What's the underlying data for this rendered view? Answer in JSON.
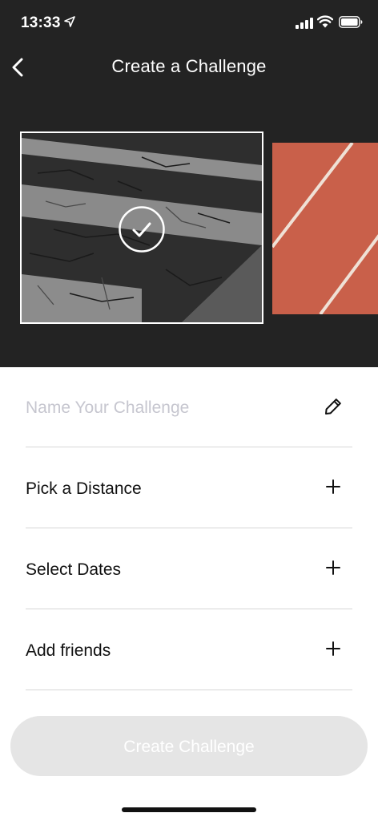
{
  "status_bar": {
    "time": "13:33",
    "icons": [
      "location-arrow-icon",
      "cellular-signal-icon",
      "wifi-icon",
      "battery-icon"
    ]
  },
  "nav": {
    "title": "Create a Challenge",
    "back_icon": "chevron-left-icon"
  },
  "cover_options": [
    {
      "name": "asphalt-crosswalk",
      "selected": true
    },
    {
      "name": "running-track",
      "selected": false
    }
  ],
  "form": {
    "name_placeholder": "Name Your Challenge",
    "name_icon": "pencil-icon",
    "rows": [
      {
        "label": "Pick a Distance",
        "icon": "plus-icon"
      },
      {
        "label": "Select Dates",
        "icon": "plus-icon"
      },
      {
        "label": "Add friends",
        "icon": "plus-icon"
      }
    ]
  },
  "create_button": {
    "label": "Create Challenge",
    "enabled": false
  },
  "colors": {
    "header_bg": "#232323",
    "placeholder_text": "#c6c6cf",
    "divider": "#d6d6d6",
    "button_disabled_bg": "#e5e5e5",
    "track_color": "#c9604a"
  }
}
